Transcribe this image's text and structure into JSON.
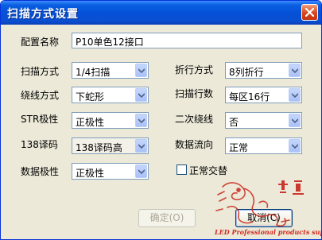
{
  "window": {
    "title": "扫描方式设置"
  },
  "form": {
    "config_name_label": "配置名称",
    "config_name_value": "P10单色12接口",
    "scan_mode_label": "扫描方式",
    "scan_mode_value": "1/4扫描",
    "fold_mode_label": "折行方式",
    "fold_mode_value": "8列折行",
    "wiring_mode_label": "绕线方式",
    "wiring_mode_value": "下蛇形",
    "scan_rows_label": "扫描行数",
    "scan_rows_value": "每区16行",
    "str_polarity_label": "STR极性",
    "str_polarity_value": "正极性",
    "secondary_wiring_label": "二次绕线",
    "secondary_wiring_value": "否",
    "decoder_label": "138译码",
    "decoder_value": "138译码高",
    "data_flow_label": "数据流向",
    "data_flow_value": "正常",
    "data_polarity_label": "数据极性",
    "data_polarity_value": "正极性",
    "alternate_label": "正常交替"
  },
  "buttons": {
    "ok_label": "确定(O)",
    "cancel_label": "取消(C)"
  },
  "logo": {
    "caption": "LED Professional products suppliers"
  }
}
